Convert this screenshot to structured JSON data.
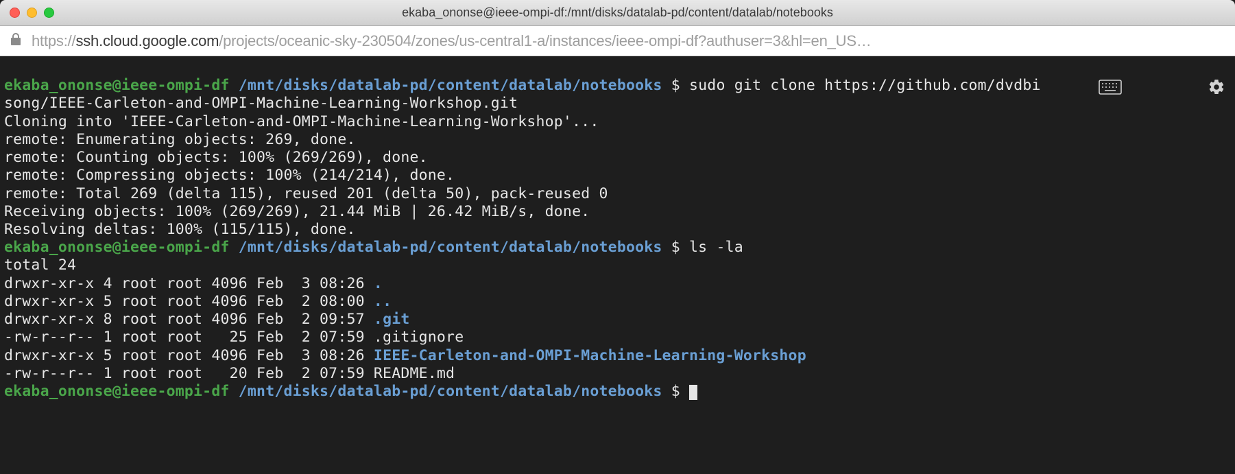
{
  "window": {
    "title": "ekaba_ononse@ieee-ompi-df:/mnt/disks/datalab-pd/content/datalab/notebooks"
  },
  "address": {
    "scheme": "https://",
    "host": "ssh.cloud.google.com",
    "path_rest": "/projects/oceanic-sky-230504/zones/us-central1-a/instances/ieee-ompi-df?authuser=3&hl=en_US…"
  },
  "prompt": {
    "user_host": "ekaba_ononse@ieee-ompi-df",
    "cwd": "/mnt/disks/datalab-pd/content/datalab/notebooks",
    "dollar": "$"
  },
  "cmd1": "sudo git clone https://github.com/dvdbi",
  "cmd1_wrap": "song/IEEE-Carleton-and-OMPI-Machine-Learning-Workshop.git",
  "out": {
    "l1": "Cloning into 'IEEE-Carleton-and-OMPI-Machine-Learning-Workshop'...",
    "l2": "remote: Enumerating objects: 269, done.",
    "l3": "remote: Counting objects: 100% (269/269), done.",
    "l4": "remote: Compressing objects: 100% (214/214), done.",
    "l5": "remote: Total 269 (delta 115), reused 201 (delta 50), pack-reused 0",
    "l6": "Receiving objects: 100% (269/269), 21.44 MiB | 26.42 MiB/s, done.",
    "l7": "Resolving deltas: 100% (115/115), done."
  },
  "cmd2": "ls -la",
  "ls": {
    "total": "total 24",
    "r1a": "drwxr-xr-x 4 root root 4096 Feb  3 08:26 ",
    "r1b": ".",
    "r2a": "drwxr-xr-x 5 root root 4096 Feb  2 08:00 ",
    "r2b": "..",
    "r3a": "drwxr-xr-x 8 root root 4096 Feb  2 09:57 ",
    "r3b": ".git",
    "r4": "-rw-r--r-- 1 root root   25 Feb  2 07:59 .gitignore",
    "r5a": "drwxr-xr-x 5 root root 4096 Feb  3 08:26 ",
    "r5b": "IEEE-Carleton-and-OMPI-Machine-Learning-Workshop",
    "r6": "-rw-r--r-- 1 root root   20 Feb  2 07:59 README.md"
  }
}
